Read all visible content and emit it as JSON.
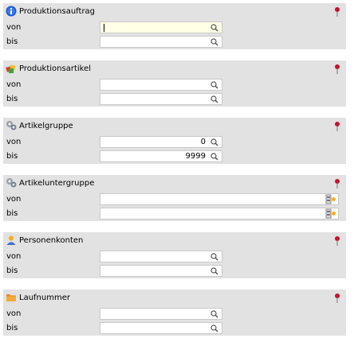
{
  "sections": [
    {
      "title": "Produktionsauftrag",
      "icon": "info-icon",
      "von": "",
      "bis": "",
      "active": true
    },
    {
      "title": "Produktionsartikel",
      "icon": "products-icon",
      "von": "",
      "bis": ""
    },
    {
      "title": "Artikelgruppe",
      "icon": "gear-group-icon",
      "von": "0",
      "bis": "9999"
    },
    {
      "title": "Artikeluntergruppe",
      "icon": "gear-group-icon",
      "von": "",
      "bis": ""
    },
    {
      "title": "Personenkonten",
      "icon": "person-icon",
      "von": "",
      "bis": ""
    },
    {
      "title": "Laufnummer",
      "icon": "folder-icon",
      "von": "",
      "bis": ""
    }
  ],
  "labels": {
    "von": "von",
    "bis": "bis"
  },
  "colors": {
    "band": "#e2e2e2",
    "active_field": "#ffffe6",
    "pin": "#c8102e"
  }
}
